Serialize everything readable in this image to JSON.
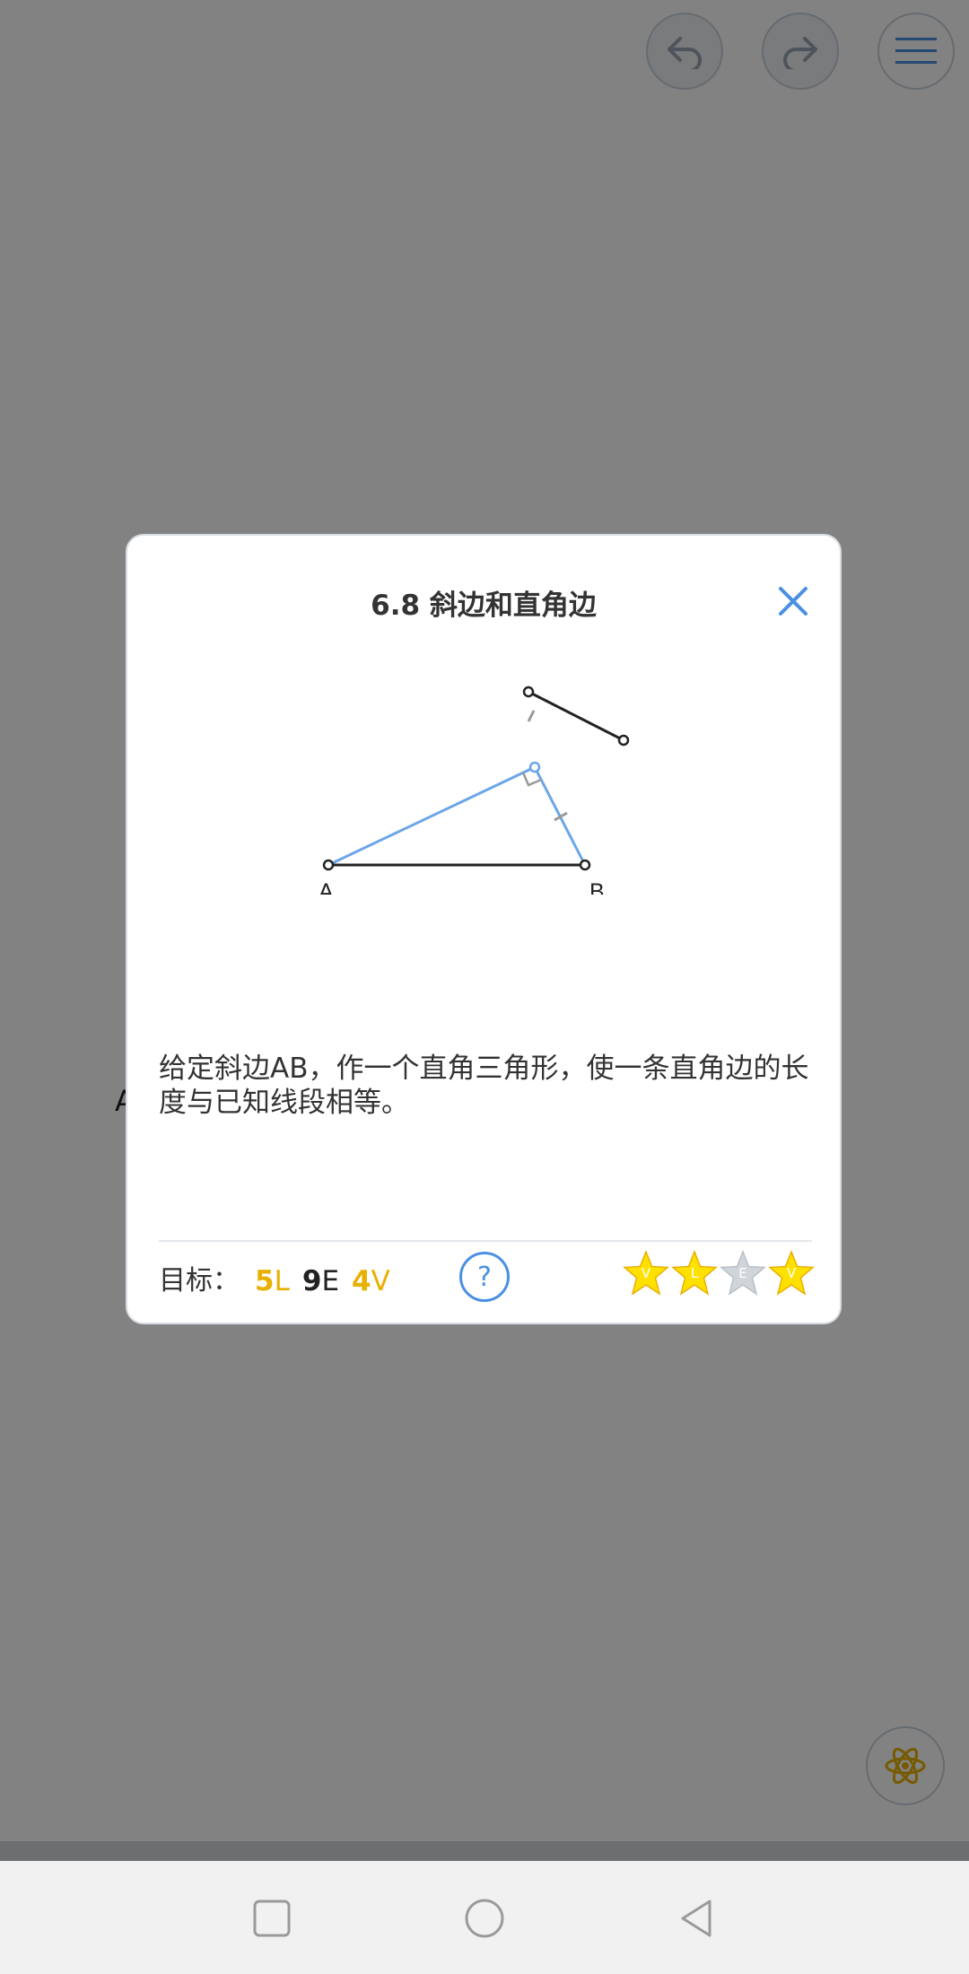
{
  "modal": {
    "title": "6.8 斜边和直角边",
    "description": "给定斜边AB，作一个直角三角形，使一条直角边的长度与已知线段相等。",
    "diagram_labels": {
      "a": "A",
      "b": "B"
    },
    "goals": {
      "label": "目标：",
      "items": [
        {
          "num": "5",
          "letter": "L",
          "color": "#e8b000"
        },
        {
          "num": "9",
          "letter": "E",
          "color": "#222222"
        },
        {
          "num": "4",
          "letter": "V",
          "color": "#e8b000"
        }
      ]
    },
    "help_label": "?",
    "stars": [
      {
        "letter": "V",
        "earned": true
      },
      {
        "letter": "L",
        "earned": true
      },
      {
        "letter": "E",
        "earned": false
      },
      {
        "letter": "V",
        "earned": true
      }
    ]
  },
  "background": {
    "partial_label": "A"
  },
  "icons": {
    "undo": "undo-icon",
    "redo": "redo-icon",
    "menu": "hamburger-menu-icon",
    "atom": "atom-icon",
    "close": "close-icon",
    "nav_recents": "square-icon",
    "nav_home": "circle-icon",
    "nav_back": "triangle-back-icon"
  },
  "colors": {
    "accent": "#4a90e2",
    "gold": "#e8b000",
    "star_gold": "#ffe100",
    "star_grey": "#d0d5da"
  }
}
